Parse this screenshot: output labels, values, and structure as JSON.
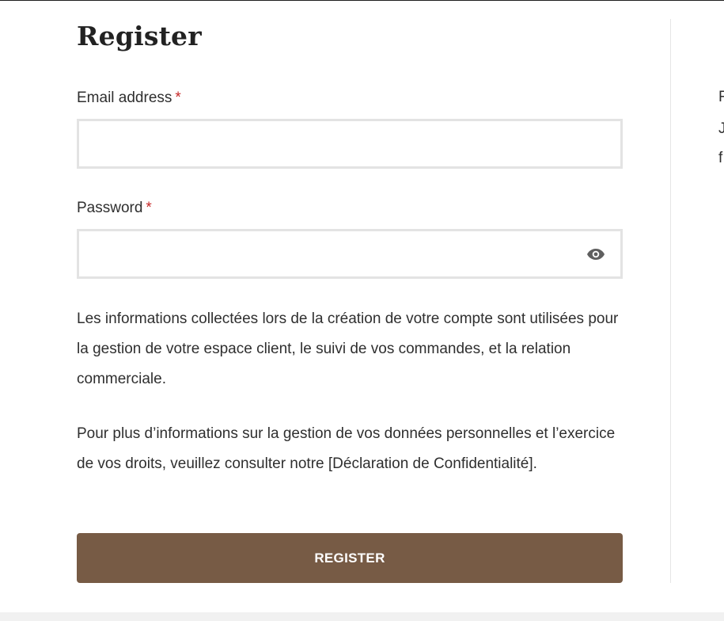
{
  "form": {
    "title": "Register",
    "email": {
      "label": "Email address",
      "required_mark": "*",
      "value": "",
      "placeholder": ""
    },
    "password": {
      "label": "Password",
      "required_mark": "*",
      "value": "",
      "placeholder": "",
      "toggle_icon": "eye-icon"
    },
    "privacy_text_1": "Les informations collectées lors de la création de votre compte sont utilisées pour la gestion de votre espace client, le suivi de vos commandes, et la relation commerciale.",
    "privacy_text_2_prefix": "Pour plus d’informations sur la gestion de vos données personnelles et l’exercice de vos droits, veuillez consulter notre ",
    "privacy_link": "[Déclaration de Confidentialité]",
    "privacy_text_2_suffix": ".",
    "submit_label": "REGISTER"
  },
  "side_column": {
    "line_1": "F",
    "line_2": "J",
    "line_3": "f"
  },
  "colors": {
    "accent_button": "#775b45",
    "required_mark": "#c62828",
    "field_border": "#e3e3e3"
  }
}
